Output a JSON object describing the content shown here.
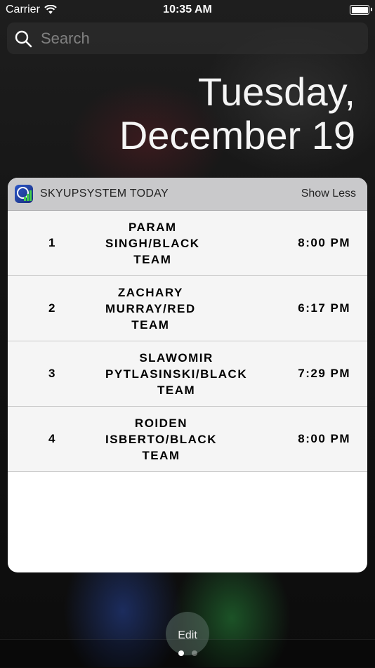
{
  "status_bar": {
    "carrier": "Carrier",
    "time": "10:35 AM"
  },
  "search": {
    "placeholder": "Search"
  },
  "date": {
    "line1": "Tuesday,",
    "line2": "December 19"
  },
  "widget": {
    "title": "SKYUPSYSTEM TODAY",
    "show_less_label": "Show Less",
    "rows": [
      {
        "rank": "1",
        "name": "PARAM\nSINGH/BLACK\nTEAM",
        "time": "8:00 PM"
      },
      {
        "rank": "2",
        "name": "ZACHARY\nMURRAY/RED\nTEAM",
        "time": "6:17 PM"
      },
      {
        "rank": "3",
        "name": "SLAWOMIR\nPYTLASINSKI/BLACK\nTEAM",
        "time": "7:29 PM"
      },
      {
        "rank": "4",
        "name": "ROIDEN\nISBERTO/BLACK\nTEAM",
        "time": "8:00 PM"
      }
    ]
  },
  "footer": {
    "edit_label": "Edit",
    "page_count": 2,
    "active_page": 1
  }
}
